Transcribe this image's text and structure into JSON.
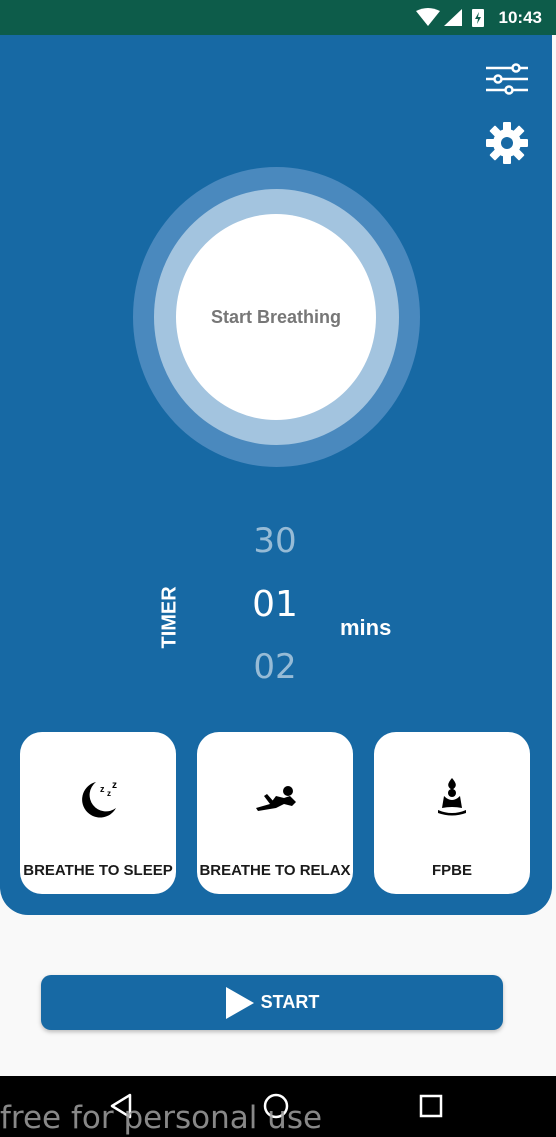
{
  "status_bar": {
    "time": "10:43"
  },
  "breathing": {
    "label": "Start Breathing"
  },
  "timer": {
    "label": "TIMER",
    "values": [
      "30",
      "01",
      "02"
    ],
    "unit": "mins"
  },
  "modes": [
    {
      "label": "BREATHE TO SLEEP",
      "icon": "sleep-moon-icon"
    },
    {
      "label": "BREATHE TO RELAX",
      "icon": "relax-person-icon"
    },
    {
      "label": "FPBE",
      "icon": "meditation-icon"
    }
  ],
  "start_button": {
    "label": "START"
  },
  "watermark": "free for personal use",
  "colors": {
    "status_bar": "#0d5c4a",
    "primary": "#1769a4",
    "ring_outer": "#4a89be",
    "ring_mid": "#a3c4df"
  }
}
